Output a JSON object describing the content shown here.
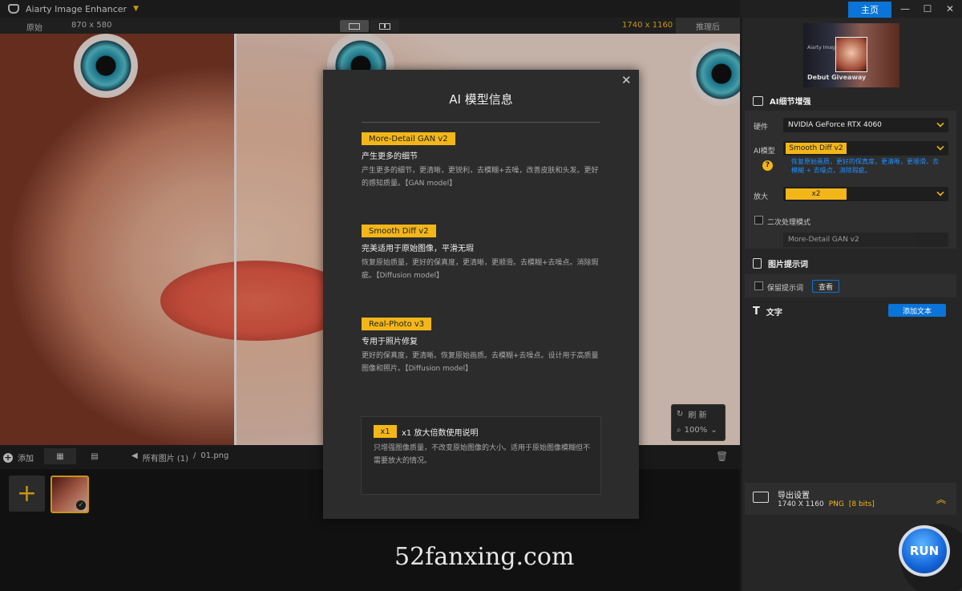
{
  "titlebar": {
    "app_title": "Aiarty Image Enhancer",
    "home_label": "主页"
  },
  "viewbar": {
    "original_label": "原始",
    "original_size": "870 x 580",
    "output_size": "1740 x 1160",
    "after_label": "推理后"
  },
  "canvas": {
    "refresh_label": "刷 新",
    "zoom_label": "100%"
  },
  "filmbar": {
    "add_label": "添加",
    "path_all": "所有图片 (1)",
    "path_sep": "/",
    "path_file": "01.png"
  },
  "sidebar": {
    "preview_text": "Aiarty Image Enhancer",
    "preview_debut": "Debut Giveaway",
    "ai_section_title": "AI细节增强",
    "hardware_label": "硬件",
    "hardware_value": "NVIDIA GeForce RTX 4060",
    "model_label": "AI模型",
    "model_value": "Smooth Diff v2",
    "model_desc": "恢复原始画质，更好的保真度，更清晰，更顺滑，去模糊 + 去噪点，消除瑕疵。",
    "scale_label": "放大",
    "scale_value": "x2",
    "second_pass_label": "二次处理模式",
    "second_pass_model": "More-Detail GAN v2",
    "prompt_section_title": "图片提示词",
    "keep_prompt_label": "保留提示词",
    "view_label": "查看",
    "text_section_title": "文字",
    "add_text_label": "添加文本"
  },
  "export": {
    "title": "导出设置",
    "size": "1740 X 1160",
    "format": "PNG",
    "bits": "[8 bits]"
  },
  "run_label": "RUN",
  "modal": {
    "title": "AI 模型信息",
    "models": [
      {
        "tag": "More-Detail GAN v2",
        "headline": "产生更多的细节",
        "body": "产生更多的细节，更清晰，更锐利，去模糊+去噪，改善皮肤和头发。更好的感知质量。【GAN model】"
      },
      {
        "tag": "Smooth Diff v2",
        "headline": "完美适用于原始图像，平滑无瑕",
        "body": "恢复原始质量，更好的保真度，更清晰，更顺滑。去模糊+去噪点。消除瑕疵。【Diffusion model】"
      },
      {
        "tag": "Real-Photo v3",
        "headline": "专用于照片修复",
        "body": "更好的保真度，更清晰。恢复原始画质。去模糊+去噪点。设计用于高质量图像和照片。【Diffusion model】"
      }
    ],
    "x1": {
      "tag": "x1",
      "title": "x1 放大倍数使用说明",
      "body": "只增强图像质量，不改变原始图像的大小。适用于原始图像模糊但不需要放大的情况。"
    }
  },
  "watermark": "52fanxing.com",
  "colors": {
    "accent": "#f3b619",
    "primary_blue": "#0a74d8",
    "panel_bg": "#262626",
    "modal_bg": "#2c2c2c"
  }
}
